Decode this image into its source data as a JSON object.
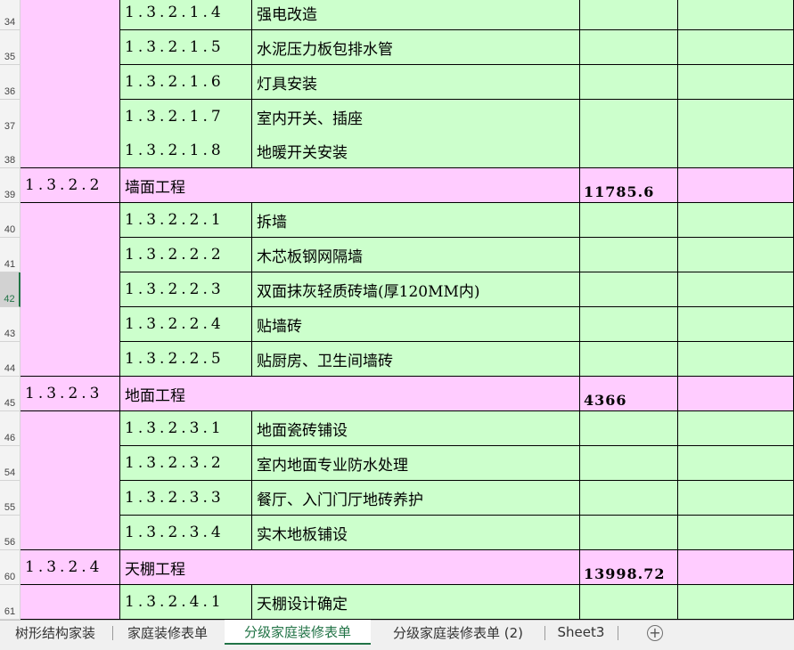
{
  "sheet": {
    "rows": [
      {
        "num": "34",
        "type": "sub",
        "code": "1.3.2.1.4",
        "name": "强电改造"
      },
      {
        "num": "35",
        "type": "sub",
        "code": "1.3.2.1.5",
        "name": "水泥压力板包排水管"
      },
      {
        "num": "36",
        "type": "sub",
        "code": "1.3.2.1.6",
        "name": "灯具安装"
      },
      {
        "num": "37",
        "type": "sub",
        "code": "1.3.2.1.7",
        "name": "室内开关、插座"
      },
      {
        "num": "38",
        "type": "sub",
        "code": "1.3.2.1.8",
        "name": "地暖开关安装"
      },
      {
        "num": "39",
        "type": "group",
        "code": "1.3.2.2",
        "name": "墙面工程",
        "amount": "11785.6"
      },
      {
        "num": "40",
        "type": "sub",
        "code": "1.3.2.2.1",
        "name": "拆墙"
      },
      {
        "num": "41",
        "type": "sub",
        "code": "1.3.2.2.2",
        "name": "木芯板钢网隔墙"
      },
      {
        "num": "42",
        "type": "sub",
        "code": "1.3.2.2.3",
        "name": "双面抹灰轻质砖墙(厚120MM内)"
      },
      {
        "num": "43",
        "type": "sub",
        "code": "1.3.2.2.4",
        "name": "贴墙砖"
      },
      {
        "num": "44",
        "type": "sub",
        "code": "1.3.2.2.5",
        "name": "贴厨房、卫生间墙砖"
      },
      {
        "num": "45",
        "type": "group",
        "code": "1.3.2.3",
        "name": "地面工程",
        "amount": "4366"
      },
      {
        "num": "46",
        "type": "sub",
        "code": "1.3.2.3.1",
        "name": "地面瓷砖铺设"
      },
      {
        "num": "54",
        "type": "sub",
        "code": "1.3.2.3.2",
        "name": "室内地面专业防水处理"
      },
      {
        "num": "55",
        "type": "sub",
        "code": "1.3.2.3.3",
        "name": "餐厅、入门门厅地砖养护"
      },
      {
        "num": "56",
        "type": "sub",
        "code": "1.3.2.3.4",
        "name": "实木地板铺设"
      },
      {
        "num": "60",
        "type": "group",
        "code": "1.3.2.4",
        "name": "天棚工程",
        "amount": "13998.72"
      },
      {
        "num": "61",
        "type": "sub",
        "code": "1.3.2.4.1",
        "name": "天棚设计确定"
      }
    ],
    "active_row": "42"
  },
  "tabs": [
    {
      "label": "树形结构家装",
      "active": false
    },
    {
      "label": "家庭装修表单",
      "active": false
    },
    {
      "label": "分级家庭装修表单",
      "active": true
    },
    {
      "label": "分级家庭装修表单 (2)",
      "active": false
    },
    {
      "label": "Sheet3",
      "active": false
    }
  ],
  "add_sheet_icon": "plus-circle-icon",
  "colors": {
    "sub_fill": "#ccffcc",
    "group_fill": "#ffccff",
    "active_tab": "#217346"
  }
}
